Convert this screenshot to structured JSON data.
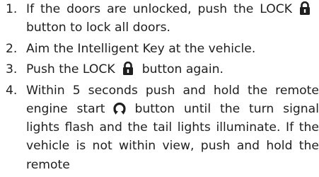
{
  "steps": [
    {
      "number": "1.",
      "text_before": "If the doors are unlocked, push the LOCK",
      "icon": "lock-icon",
      "text_after": "button to lock all doors."
    },
    {
      "number": "2.",
      "text": "Aim the Intelligent Key at the vehicle."
    },
    {
      "number": "3.",
      "text_before": "Push the LOCK",
      "icon": "lock-icon",
      "text_after": "button again."
    },
    {
      "number": "4.",
      "text_before": "Within 5 seconds push and hold the remote engine start",
      "icon": "remote-engine-start-icon",
      "text_after": "button until the turn signal lights flash and the tail lights illuminate. If the vehicle is not within view, push and hold the remote"
    }
  ],
  "colors": {
    "text": "#1f1f1f",
    "background": "#ffffff"
  }
}
